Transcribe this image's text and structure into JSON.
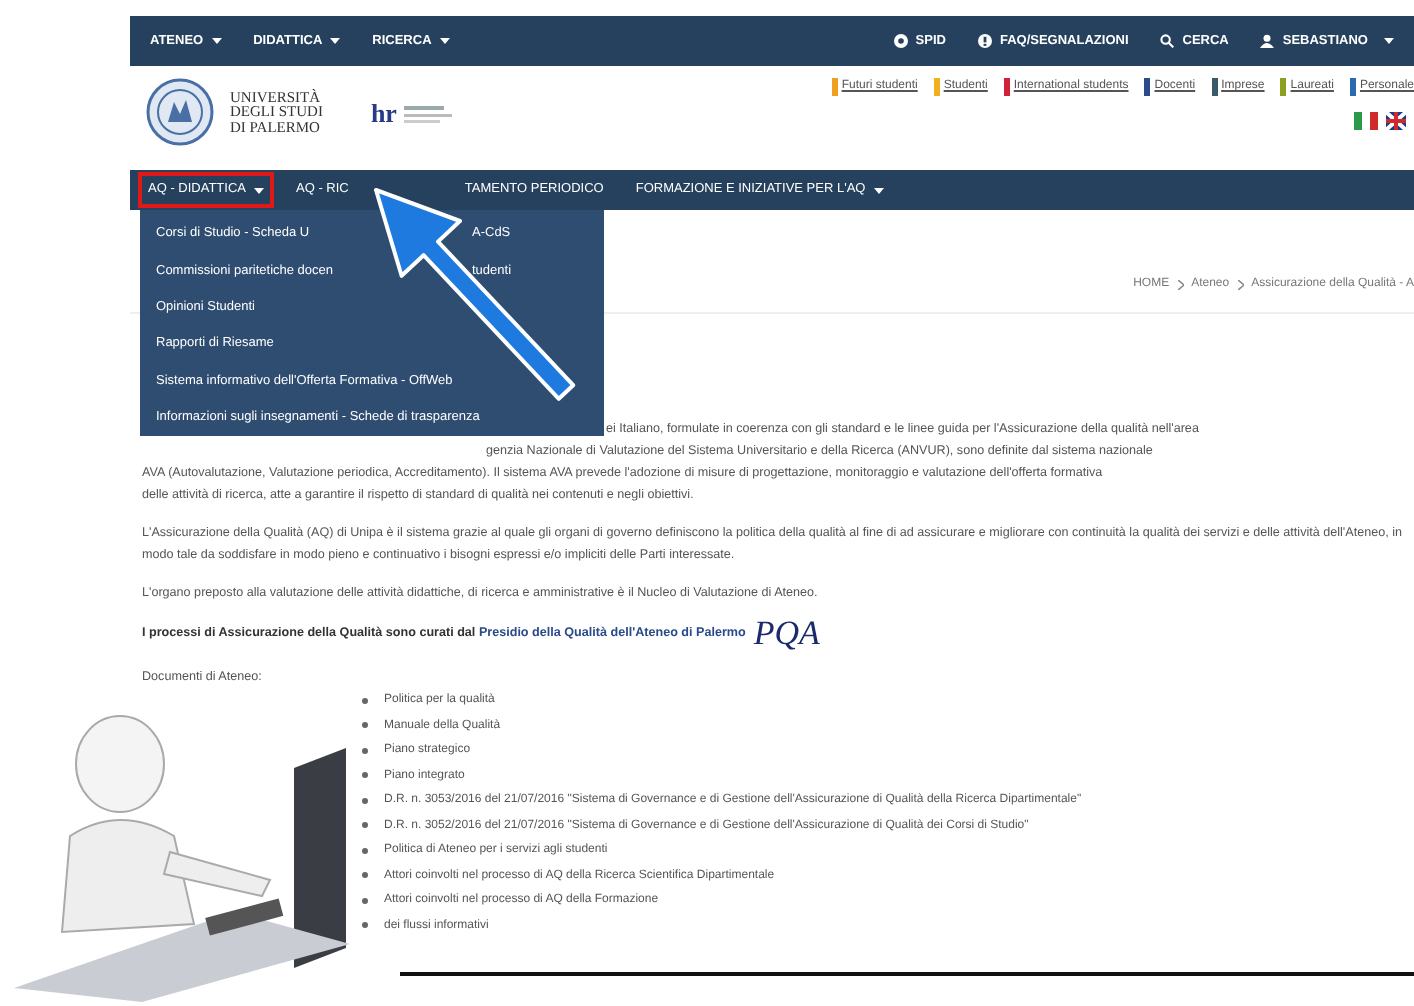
{
  "top_bar": {
    "menu": [
      {
        "label": "ATENEO",
        "dropdown": true
      },
      {
        "label": "DIDATTICA",
        "dropdown": true
      },
      {
        "label": "RICERCA",
        "dropdown": true
      }
    ],
    "links": [
      {
        "kind": "spid",
        "label": "SPID",
        "dropdown": false
      },
      {
        "kind": "faq",
        "label": "FAQ/SEGNALAZIONI",
        "dropdown": false
      },
      {
        "kind": "search",
        "label": "CERCA",
        "dropdown": false
      },
      {
        "kind": "user",
        "label": "SEBASTIANO",
        "dropdown": true
      }
    ]
  },
  "header": {
    "logo_lines": [
      "UNIVERSITÀ",
      "DEGLI STUDI",
      "DI PALERMO"
    ],
    "hr_logo": "hr",
    "audience_links": [
      {
        "label": "Futuri studenti",
        "color": "#f0a020"
      },
      {
        "label": "Studenti",
        "color": "#f0b020"
      },
      {
        "label": "International students",
        "color": "#d0203a"
      },
      {
        "label": "Docenti",
        "color": "#2a4a8a"
      },
      {
        "label": "Imprese",
        "color": "#3a5a6a"
      },
      {
        "label": "Laureati",
        "color": "#8aa020"
      },
      {
        "label": "Personale",
        "color": "#2a6ab0"
      }
    ]
  },
  "main_nav": [
    {
      "label": "AQ - DIDATTICA",
      "selected": true,
      "dropdown": true,
      "kind": "whole"
    },
    {
      "label": "AQ - RIC",
      "selected": false,
      "dropdown": false,
      "kind": "whole"
    },
    {
      "label": "TAMENTO PERIODICO",
      "selected": false,
      "dropdown": false,
      "kind": "covered_start"
    },
    {
      "label": "FORMAZIONE E INIZIATIVE PER L'AQ",
      "selected": false,
      "dropdown": true,
      "kind": "whole"
    }
  ],
  "dropdown": [
    {
      "parts": [
        "Corsi di Studio - Scheda U",
        "A-CdS"
      ]
    },
    {
      "parts": [
        "Commissioni paritetiche docen",
        "tudenti"
      ]
    },
    {
      "parts": [
        "Opinioni Studenti"
      ]
    },
    {
      "parts": [
        "Rapporti di Riesame"
      ]
    },
    {
      "parts": [
        "Sistema informativo dell'Offerta Formativa - OffWeb"
      ]
    },
    {
      "parts": [
        "Informazioni sugli insegnamenti - Schede di trasparenza"
      ]
    }
  ],
  "breadcrumb": [
    "HOME",
    "Ateneo",
    "Assicurazione della Qualità - A"
  ],
  "content": {
    "intro_lines": [
      {
        "kind": "partial",
        "text": "ei Italiano, formulate in coerenza con gli standard e le linee guida per l'Assicurazione della qualità nell'area"
      },
      {
        "kind": "partial",
        "text": "genzia Nazionale di Valutazione del Sistema Universitario e della Ricerca (ANVUR), sono definite dal sistema nazionale"
      },
      {
        "kind": "full",
        "text": "AVA (Autovalutazione, Valutazione periodica, Accreditamento). Il sistema AVA prevede l'adozione di misure di progettazione, monitoraggio e valutazione dell'offerta formativa"
      },
      {
        "kind": "full",
        "text": "delle attività di ricerca, atte a garantire il rispetto di standard di qualità nei contenuti e negli obiettivi."
      }
    ],
    "paragraphs": [
      "L'Assicurazione della Qualità (AQ) di Unipa è il sistema grazie al quale gli organi di governo definiscono la politica della qualità al fine di ad assicurare e migliorare con continuità la qualità dei servizi e delle attività dell'Ateneo, in modo tale da soddisfare in modo pieno e continuativo i bisogni espressi e/o impliciti delle Parti interessate.",
      "L'organo preposto alla valutazione delle attività didattiche, di ricerca e amministrative è il Nucleo di Valutazione di Ateneo."
    ],
    "processes": {
      "text": "I processi di Assicurazione della Qualità sono curati dal",
      "link": "Presidio della Qualità dell'Ateneo di Palermo",
      "logo": "PQA"
    },
    "documents_title": "Documenti di Ateneo:",
    "documents": [
      "Politica per la qualità",
      "Manuale della Qualità",
      "Piano strategico",
      "Piano integrato",
      "D.R. n. 3053/2016 del 21/07/2016 \"Sistema di Governance e di Gestione dell'Assicurazione di Qualità della Ricerca Dipartimentale\"",
      "D.R. n. 3052/2016 del 21/07/2016 \"Sistema di Governance e di Gestione dell'Assicurazione di Qualità dei Corsi di Studio\"",
      "Politica di Ateneo per i servizi agli studenti",
      "Attori coinvolti nel processo di AQ della Ricerca Scientifica Dipartimentale",
      "Attori coinvolti nel processo di AQ della Formazione",
      "dei flussi informativi"
    ]
  }
}
